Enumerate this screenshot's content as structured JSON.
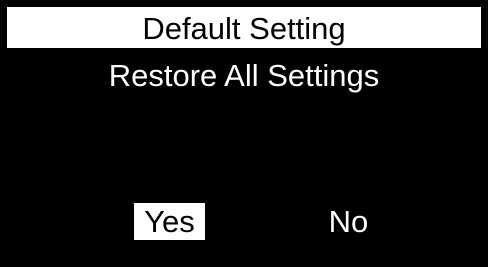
{
  "dialog": {
    "title": "Default Setting",
    "prompt": "Restore All Settings",
    "options": [
      {
        "label": "Yes",
        "selected": true
      },
      {
        "label": "No",
        "selected": false
      }
    ]
  },
  "colors": {
    "background": "#000000",
    "foreground": "#ffffff",
    "highlight_bg": "#ffffff",
    "highlight_fg": "#000000"
  }
}
